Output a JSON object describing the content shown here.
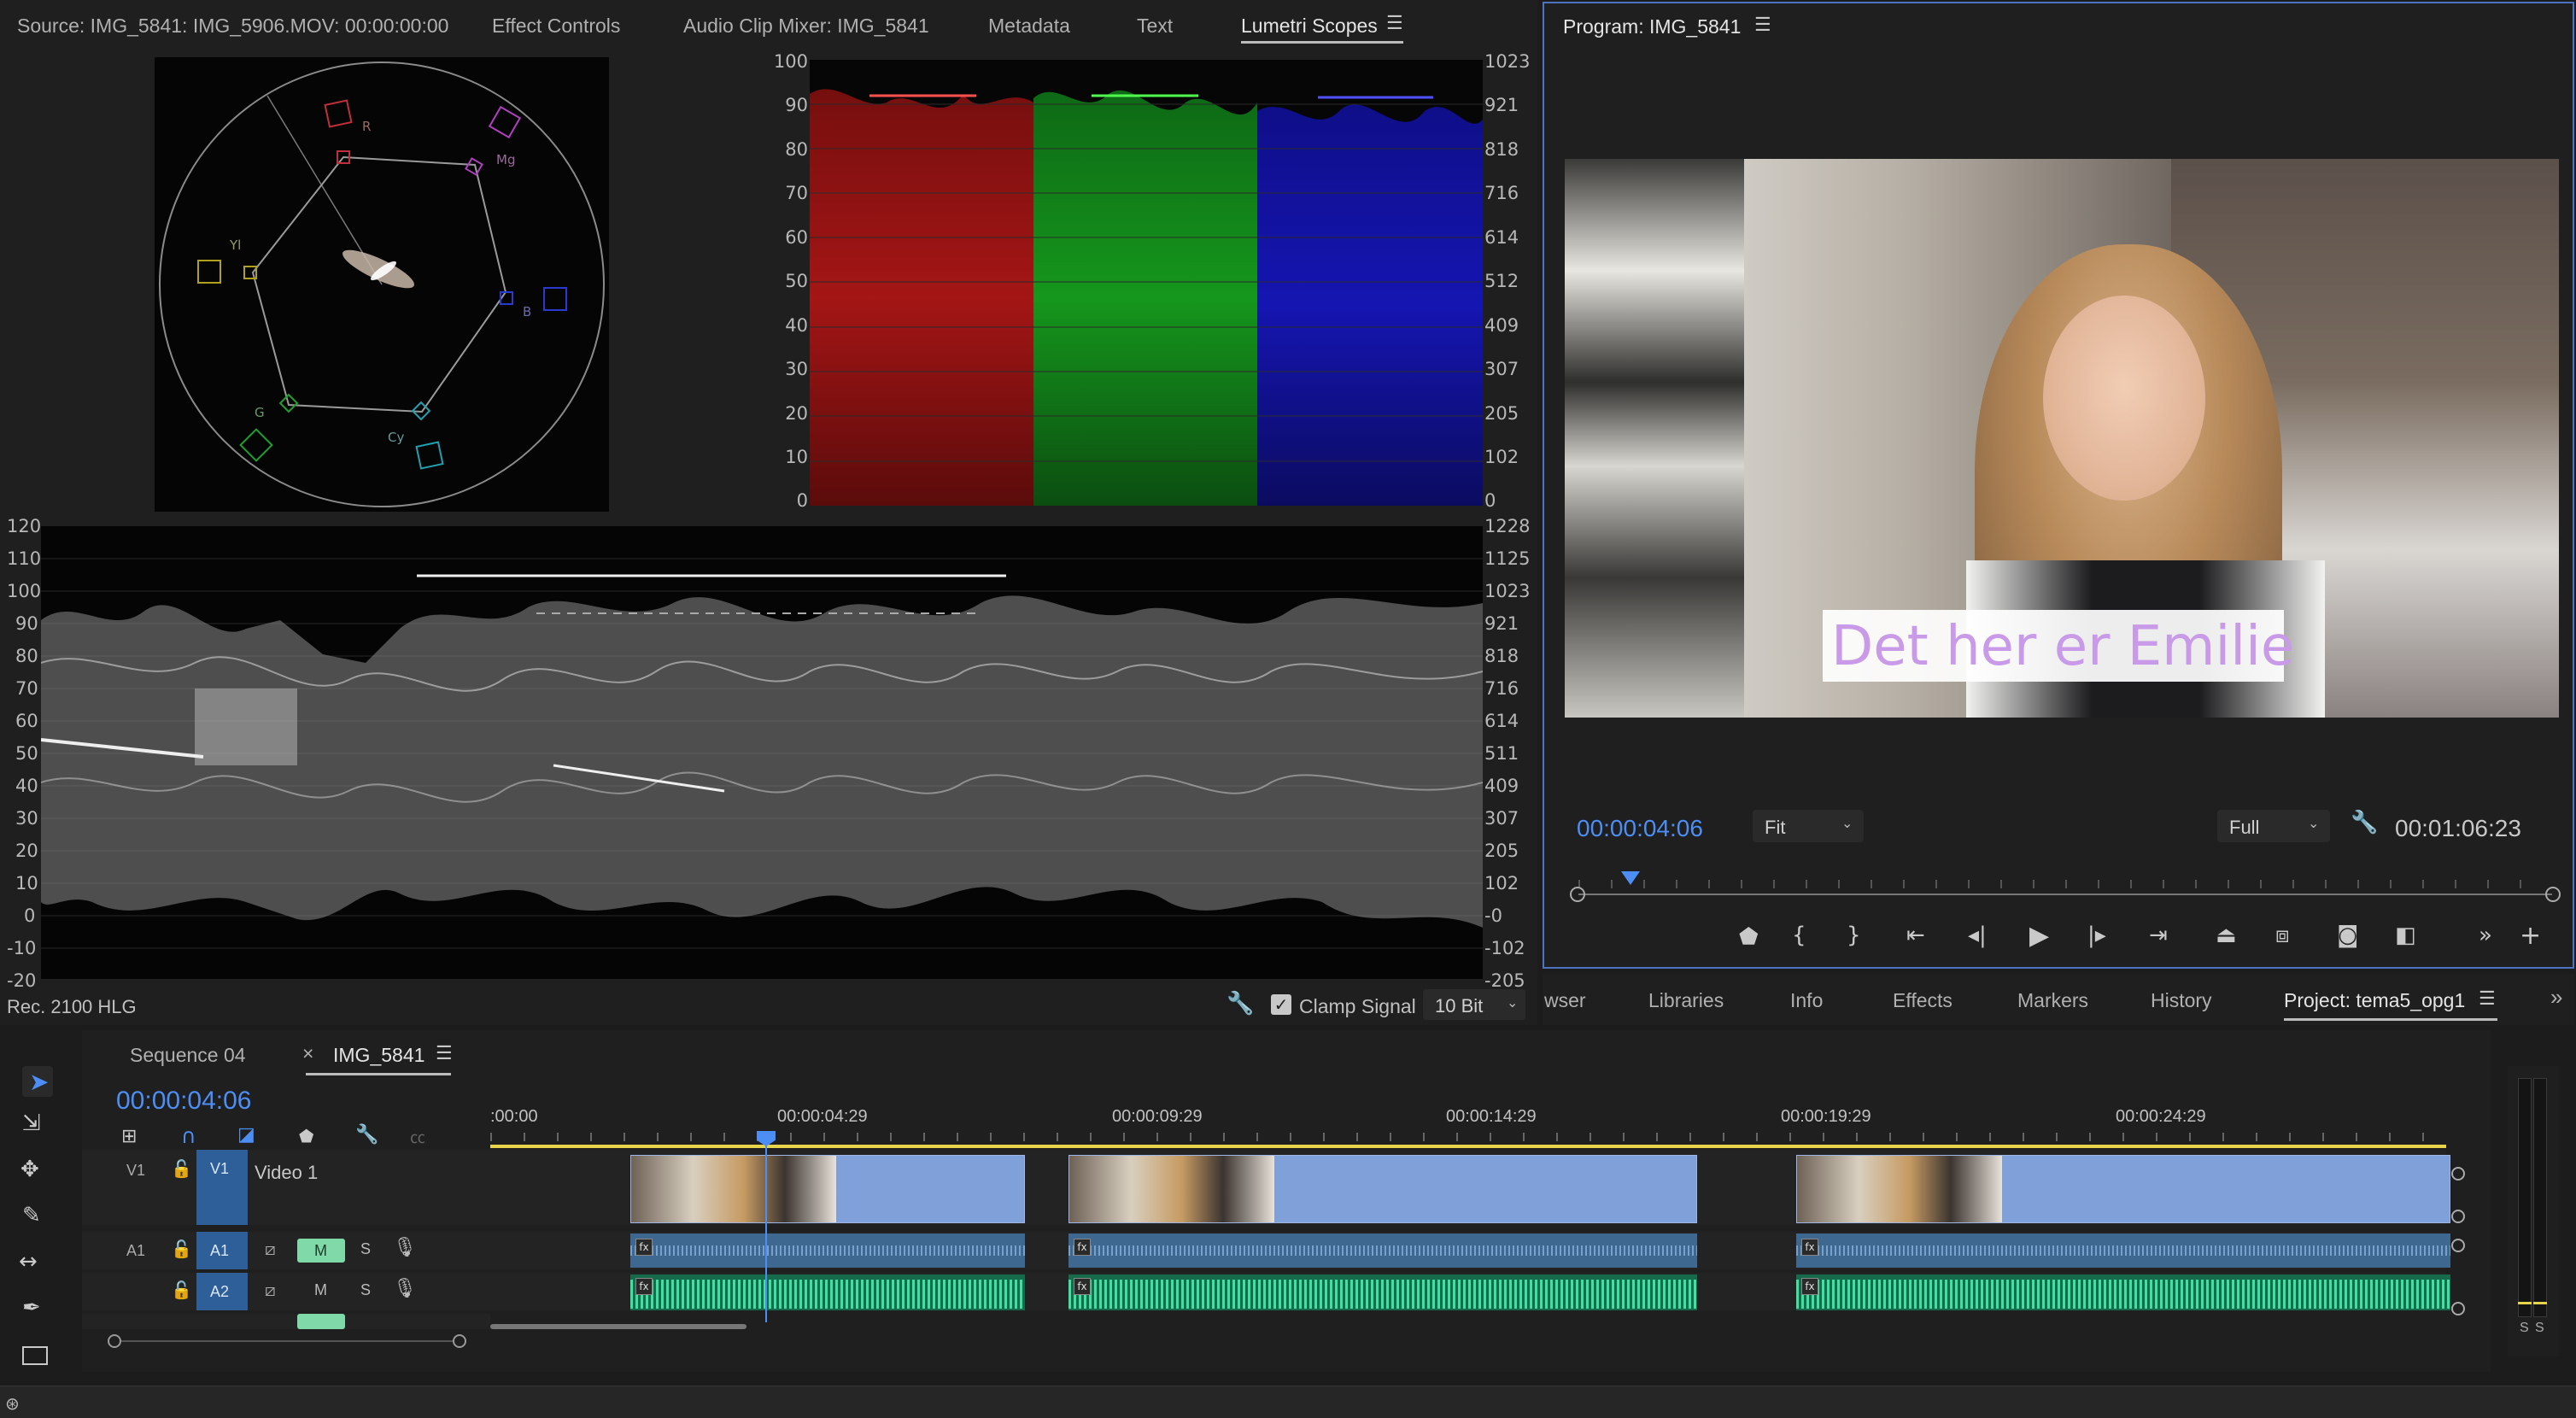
{
  "source_panel": {
    "tabs": [
      {
        "label": "Source: IMG_5841: IMG_5906.MOV: 00:00:00:00",
        "active": false
      },
      {
        "label": "Effect Controls",
        "active": false
      },
      {
        "label": "Audio Clip Mixer: IMG_5841",
        "active": false
      },
      {
        "label": "Metadata",
        "active": false
      },
      {
        "label": "Text",
        "active": false
      },
      {
        "label": "Lumetri Scopes",
        "active": true
      }
    ],
    "menu_icon": "hamburger-icon"
  },
  "vectorscope": {
    "labels": [
      "R",
      "Mg",
      "B",
      "Cy",
      "G",
      "Yl"
    ]
  },
  "parade": {
    "left_scale": [
      "100",
      "90",
      "80",
      "70",
      "60",
      "50",
      "40",
      "30",
      "20",
      "10",
      "0"
    ],
    "right_scale": [
      "1023",
      "921",
      "818",
      "716",
      "614",
      "512",
      "409",
      "307",
      "205",
      "102",
      "0"
    ]
  },
  "waveform": {
    "left_scale": [
      "120",
      "110",
      "100",
      "90",
      "80",
      "70",
      "60",
      "50",
      "40",
      "30",
      "20",
      "10",
      "0",
      "-10",
      "-20"
    ],
    "right_scale": [
      "1228",
      "1125",
      "1023",
      "921",
      "818",
      "716",
      "614",
      "511",
      "409",
      "307",
      "205",
      "102",
      "-0",
      "-102",
      "-205"
    ]
  },
  "scopes_footer": {
    "color_space": "Rec. 2100 HLG",
    "clamp_label": "Clamp Signal",
    "clamp_checked": true,
    "bit_depth": "10 Bit"
  },
  "program_monitor": {
    "title": "Program: IMG_5841",
    "overlay_text": "Det her er Emilie",
    "timecode": "00:00:04:06",
    "fit": "Fit",
    "resolution": "Full",
    "duration": "00:01:06:23",
    "playhead_fraction": 0.05,
    "transport_icons": [
      "marker-icon",
      "mark-in-icon",
      "mark-out-icon",
      "go-to-in-icon",
      "step-back-icon",
      "play-icon",
      "step-forward-icon",
      "go-to-out-icon",
      "lift-icon",
      "extract-icon",
      "camera-icon",
      "compare-icon",
      "more-icon",
      "add-icon"
    ]
  },
  "project_panel": {
    "tabs": [
      {
        "label": "wser",
        "active": false
      },
      {
        "label": "Libraries",
        "active": false
      },
      {
        "label": "Info",
        "active": false
      },
      {
        "label": "Effects",
        "active": false
      },
      {
        "label": "Markers",
        "active": false
      },
      {
        "label": "History",
        "active": false
      },
      {
        "label": "Project: tema5_opg1",
        "active": true
      }
    ],
    "more": "»"
  },
  "timeline": {
    "tabs": [
      {
        "label": "Sequence 04",
        "active": false
      },
      {
        "label": "IMG_5841",
        "active": true
      }
    ],
    "timecode": "00:00:04:06",
    "ruler": [
      ":00:00",
      "00:00:04:29",
      "00:00:09:29",
      "00:00:14:29",
      "00:00:19:29",
      "00:00:24:29"
    ],
    "tracks": {
      "v1": {
        "id": "V1",
        "target": "V1",
        "name": "Video 1"
      },
      "a1": {
        "id": "A1",
        "target": "A1",
        "m": "M",
        "s": "S"
      },
      "a2": {
        "id": "",
        "target": "A2",
        "m": "M",
        "s": "S"
      }
    },
    "fx": "fx"
  },
  "tools": [
    "selection-tool-icon",
    "track-select-tool-icon",
    "ripple-edit-tool-icon",
    "razor-tool-icon",
    "slip-tool-icon",
    "pen-tool-icon",
    "rectangle-tool-icon"
  ],
  "meter": {
    "labels": [
      "S",
      "S"
    ]
  },
  "colors": {
    "accent": "#4d8ef5",
    "playhead": "#4d8ef5",
    "clip_video": "#7fa0d9",
    "clip_audio1": "#3f6890",
    "clip_audio2": "#156b4b",
    "mute_on": "#7fd9a8"
  }
}
